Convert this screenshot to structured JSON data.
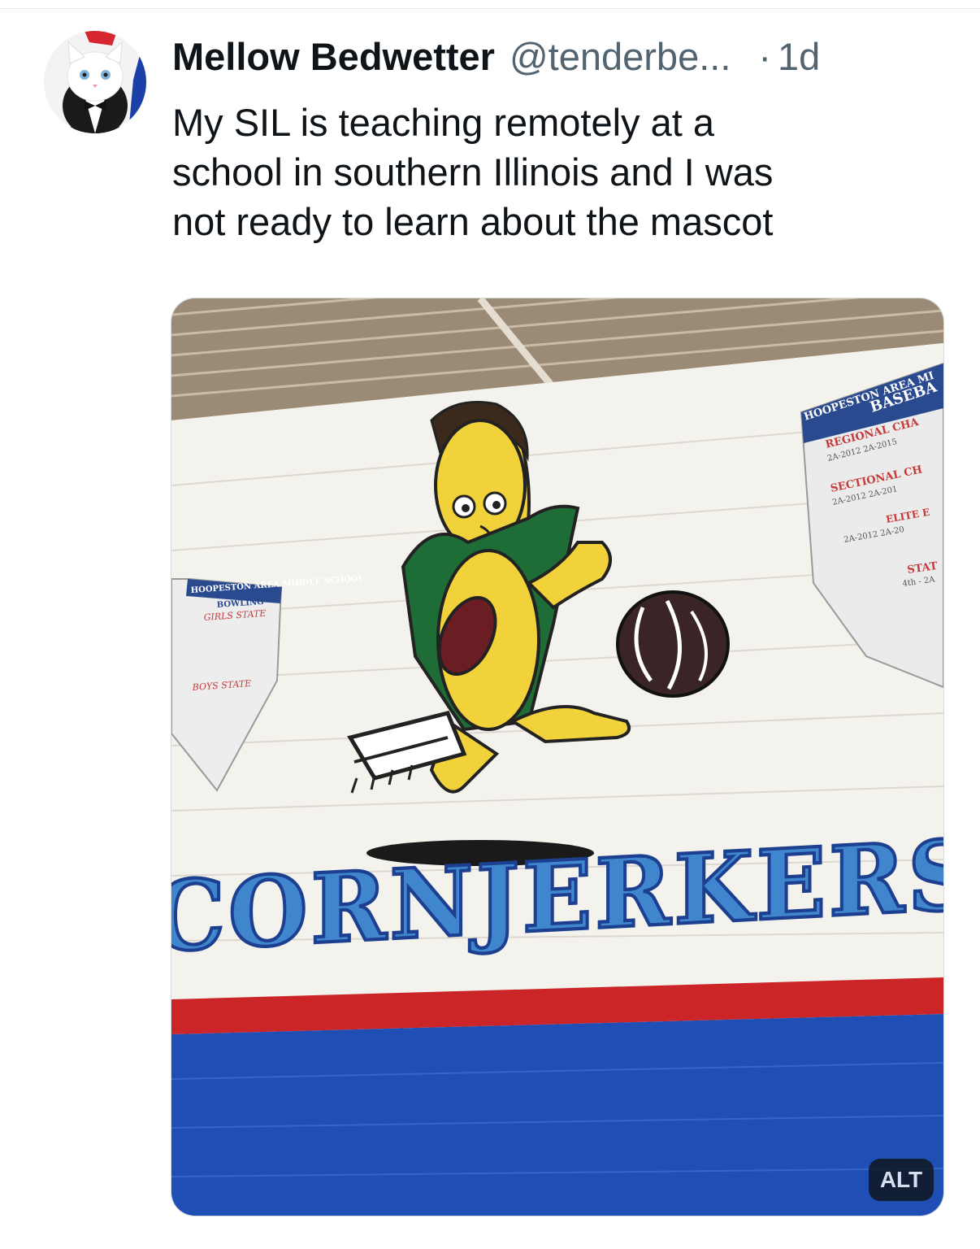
{
  "tweet": {
    "display_name": "Mellow Bedwetter",
    "handle": "@tenderbe...",
    "separator": "·",
    "timestamp": "1d",
    "text": "My SIL is teaching remotely at a\nschool in southern Illinois and I was\nnot ready to learn about the mascot"
  },
  "media": {
    "mural_word": "CORNJERKERS",
    "alt_badge": "ALT",
    "banner_left": {
      "title": "HOOPESTON AREA MIDDLE SCHOOL",
      "sport": "BOWLING",
      "row1": "GIRLS STATE",
      "row2": "BOYS STATE"
    },
    "banner_right": {
      "title": "HOOPESTON AREA MI",
      "sport": "BASEBA",
      "row1": "REGIONAL CHA",
      "row1_years": "2A-2012  2A-2015",
      "row2": "SECTIONAL CH",
      "row2_years": "2A-2012  2A-201",
      "row3": "ELITE E",
      "row3_years": "2A-2012  2A-20",
      "row4": "STAT",
      "row4_years": "4th - 2A"
    }
  },
  "colors": {
    "wall": "#f4f2ec",
    "stripe_red": "#cc2528",
    "stripe_blue": "#1f4fb4",
    "mascot_yellow": "#f2d23a",
    "mascot_green": "#1f6d36",
    "letters_blue": "#3f86cf"
  }
}
